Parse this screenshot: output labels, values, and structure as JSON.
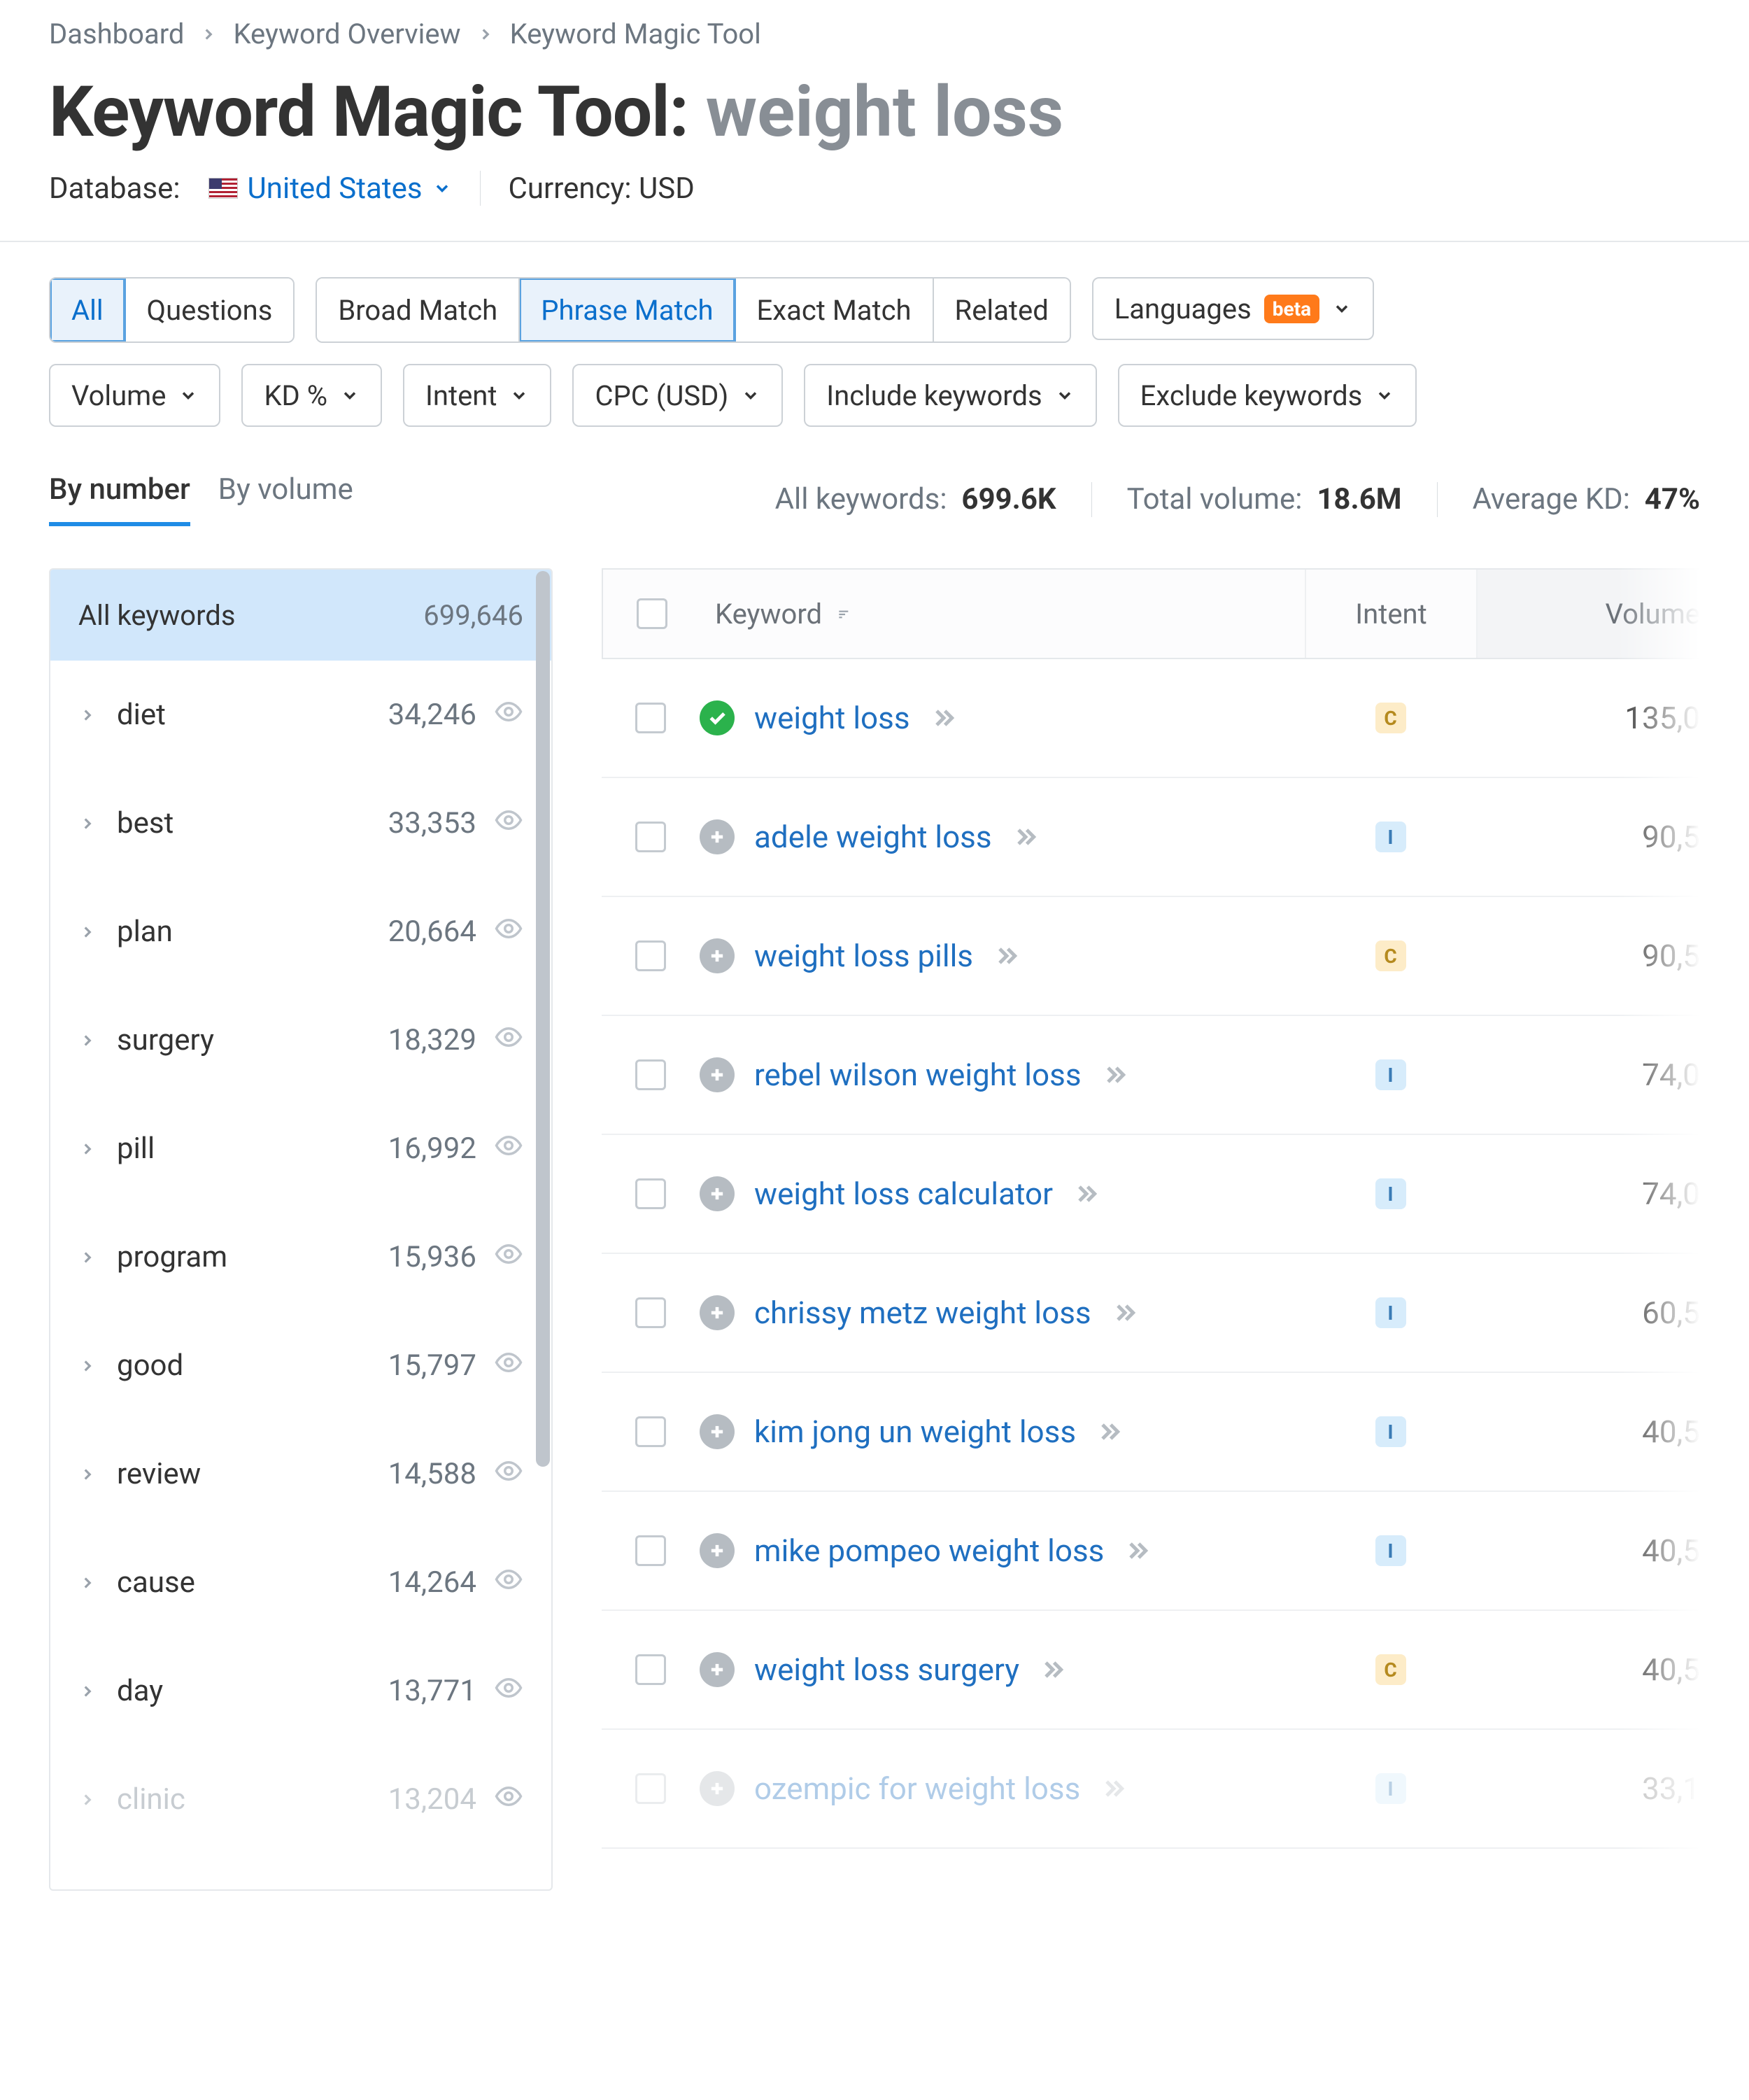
{
  "breadcrumb": [
    "Dashboard",
    "Keyword Overview",
    "Keyword Magic Tool"
  ],
  "title": {
    "prefix": "Keyword Magic Tool:",
    "query": "weight loss"
  },
  "meta": {
    "db_label": "Database:",
    "db_value": "United States",
    "currency_label": "Currency:",
    "currency_value": "USD"
  },
  "filters": {
    "row1": {
      "group1": [
        {
          "label": "All",
          "active": true
        },
        {
          "label": "Questions",
          "active": false
        }
      ],
      "group2": [
        {
          "label": "Broad Match",
          "active": false
        },
        {
          "label": "Phrase Match",
          "active": true
        },
        {
          "label": "Exact Match",
          "active": false
        },
        {
          "label": "Related",
          "active": false
        }
      ],
      "languages": {
        "label": "Languages",
        "badge": "beta"
      }
    },
    "row2": [
      "Volume",
      "KD %",
      "Intent",
      "CPC (USD)",
      "Include keywords",
      "Exclude keywords"
    ]
  },
  "tabs": {
    "by_number": "By number",
    "by_volume": "By volume"
  },
  "summary": {
    "all_label": "All keywords:",
    "all_value": "699.6K",
    "vol_label": "Total volume:",
    "vol_value": "18.6M",
    "kd_label": "Average KD:",
    "kd_value": "47%"
  },
  "sidebar": {
    "header_label": "All keywords",
    "header_count": "699,646",
    "items": [
      {
        "term": "diet",
        "count": "34,246"
      },
      {
        "term": "best",
        "count": "33,353"
      },
      {
        "term": "plan",
        "count": "20,664"
      },
      {
        "term": "surgery",
        "count": "18,329"
      },
      {
        "term": "pill",
        "count": "16,992"
      },
      {
        "term": "program",
        "count": "15,936"
      },
      {
        "term": "good",
        "count": "15,797"
      },
      {
        "term": "review",
        "count": "14,588"
      },
      {
        "term": "cause",
        "count": "14,264"
      },
      {
        "term": "day",
        "count": "13,771"
      },
      {
        "term": "clinic",
        "count": "13,204",
        "faded": true
      }
    ]
  },
  "table": {
    "headers": {
      "keyword": "Keyword",
      "intent": "Intent",
      "volume": "Volume"
    },
    "rows": [
      {
        "keyword": "weight loss",
        "intent": "C",
        "volume": "135,0",
        "added": true
      },
      {
        "keyword": "adele weight loss",
        "intent": "I",
        "volume": "90,5"
      },
      {
        "keyword": "weight loss pills",
        "intent": "C",
        "volume": "90,5"
      },
      {
        "keyword": "rebel wilson weight loss",
        "intent": "I",
        "volume": "74,0"
      },
      {
        "keyword": "weight loss calculator",
        "intent": "I",
        "volume": "74,0"
      },
      {
        "keyword": "chrissy metz weight loss",
        "intent": "I",
        "volume": "60,5"
      },
      {
        "keyword": "kim jong un weight loss",
        "intent": "I",
        "volume": "40,5"
      },
      {
        "keyword": "mike pompeo weight loss",
        "intent": "I",
        "volume": "40,5"
      },
      {
        "keyword": "weight loss surgery",
        "intent": "C",
        "volume": "40,5"
      },
      {
        "keyword": "ozempic for weight loss",
        "intent": "I",
        "volume": "33,1",
        "faded": true
      }
    ]
  }
}
